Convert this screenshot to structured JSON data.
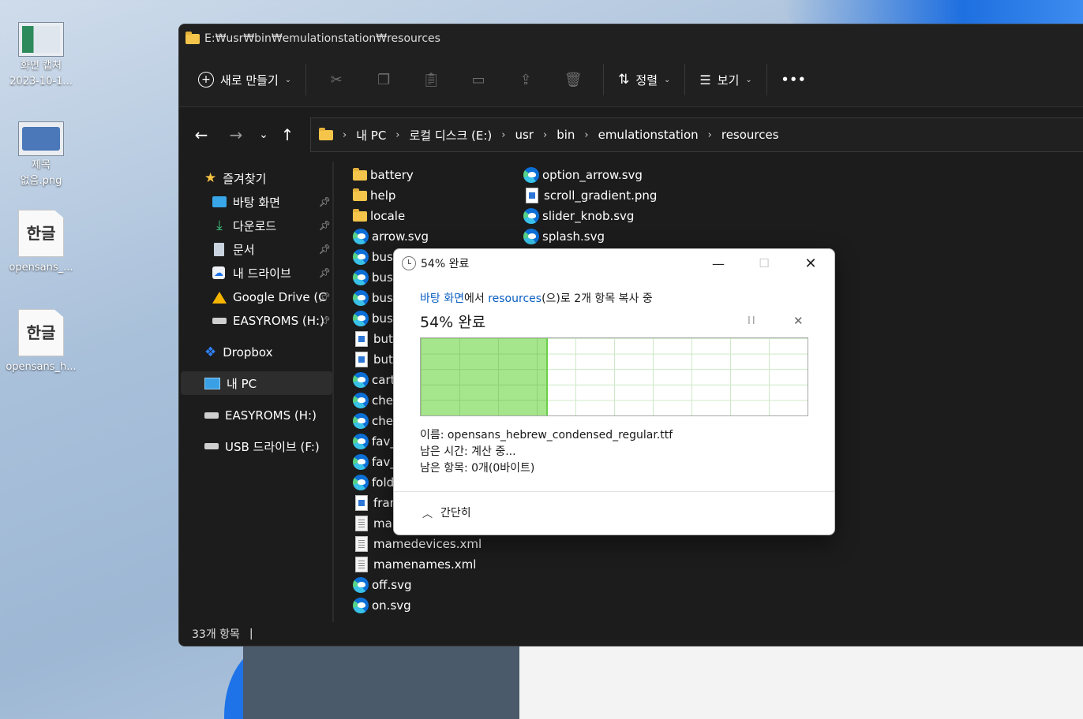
{
  "desktop": {
    "icons": [
      {
        "label": "화면 캡처\n2023-10-1...",
        "type": "screenshot"
      },
      {
        "label": "제목\n없음.png",
        "type": "image"
      },
      {
        "label": "opensans_...",
        "type": "hwp",
        "glyph": "한글"
      },
      {
        "label": "opensans_h...",
        "type": "hwp",
        "glyph": "한글"
      }
    ]
  },
  "explorer": {
    "title_path": "E:₩usr₩bin₩emulationstation₩resources",
    "toolbar": {
      "new_label": "새로 만들기",
      "sort_label": "정렬",
      "view_label": "보기",
      "more_label": "•••"
    },
    "breadcrumb": [
      "내 PC",
      "로컬 디스크 (E:)",
      "usr",
      "bin",
      "emulationstation",
      "resources"
    ],
    "sidebar": {
      "favorites_label": "즐겨찾기",
      "items": [
        {
          "label": "바탕 화면",
          "icon": "desktop-icon",
          "pinned": true
        },
        {
          "label": "다운로드",
          "icon": "download-icon",
          "pinned": true
        },
        {
          "label": "문서",
          "icon": "document-icon",
          "pinned": true
        },
        {
          "label": "내 드라이브",
          "icon": "cloud-drive-icon",
          "pinned": true
        },
        {
          "label": "Google Drive (C",
          "icon": "google-drive-icon",
          "pinned": true
        },
        {
          "label": "EASYROMS (H:)",
          "icon": "drive-icon",
          "pinned": true
        }
      ],
      "dropbox_label": "Dropbox",
      "mypc_label": "내 PC",
      "easyroms_label": "EASYROMS (H:)",
      "usb_label": "USB 드라이브 (F:)"
    },
    "files_col1": [
      {
        "name": "battery",
        "type": "folder"
      },
      {
        "name": "help",
        "type": "folder"
      },
      {
        "name": "locale",
        "type": "folder"
      },
      {
        "name": "arrow.svg",
        "type": "svg"
      },
      {
        "name": "busy",
        "type": "svg"
      },
      {
        "name": "busy",
        "type": "svg"
      },
      {
        "name": "busy",
        "type": "svg"
      },
      {
        "name": "busy",
        "type": "svg"
      },
      {
        "name": "butt",
        "type": "png"
      },
      {
        "name": "butt",
        "type": "png"
      },
      {
        "name": "cartr",
        "type": "svg"
      },
      {
        "name": "chec",
        "type": "svg"
      },
      {
        "name": "chec",
        "type": "svg"
      },
      {
        "name": "fav_",
        "type": "svg"
      },
      {
        "name": "fav_",
        "type": "svg"
      },
      {
        "name": "fold",
        "type": "svg"
      },
      {
        "name": "fram",
        "type": "png"
      },
      {
        "name": "man",
        "type": "xml"
      },
      {
        "name": "mamedevices.xml",
        "type": "xml"
      },
      {
        "name": "mamenames.xml",
        "type": "xml"
      },
      {
        "name": "off.svg",
        "type": "svg"
      },
      {
        "name": "on.svg",
        "type": "svg"
      }
    ],
    "files_col2": [
      {
        "name": "option_arrow.svg",
        "type": "svg"
      },
      {
        "name": "scroll_gradient.png",
        "type": "png"
      },
      {
        "name": "slider_knob.svg",
        "type": "svg"
      },
      {
        "name": "splash.svg",
        "type": "svg"
      }
    ],
    "status_count": "33개 항목",
    "status_sep": "|"
  },
  "copy_dialog": {
    "title": "54% 완료",
    "from_link": "바탕 화면",
    "from_suffix": "에서 ",
    "to_link": "resources",
    "to_suffix": "(으)로 2개 항목 복사 중",
    "progress_label": "54% 완료",
    "progress_percent": 54,
    "pause_glyph": "II",
    "cancel_glyph": "✕",
    "name_line": "이름: opensans_hebrew_condensed_regular.ttf",
    "time_line": "남은 시간: 계산 중...",
    "items_line": "남은 항목: 0개(0바이트)",
    "collapse_label": "간단히",
    "colors": {
      "fill": "#a5e58c",
      "link": "#0a5ec2"
    }
  }
}
